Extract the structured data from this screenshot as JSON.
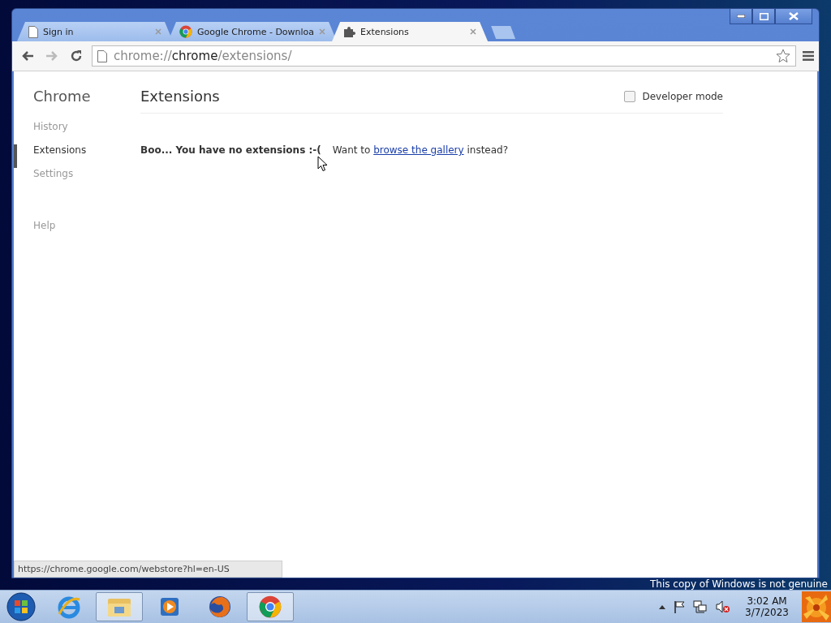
{
  "tabs": [
    {
      "title": "Sign in",
      "kind": "page",
      "selected": false
    },
    {
      "title": "Google Chrome - Downloa",
      "kind": "chrome",
      "selected": false
    },
    {
      "title": "Extensions",
      "kind": "puzzle",
      "selected": true
    }
  ],
  "toolbar": {
    "url_scheme": "chrome://",
    "url_host": "chrome",
    "url_path": "/extensions/"
  },
  "sidebar": {
    "title": "Chrome",
    "sections": [
      [
        {
          "label": "History",
          "selected": false
        },
        {
          "label": "Extensions",
          "selected": true
        },
        {
          "label": "Settings",
          "selected": false
        }
      ],
      [
        {
          "label": "Help",
          "selected": false
        }
      ]
    ]
  },
  "page": {
    "title": "Extensions",
    "developer_mode": {
      "label": "Developer mode",
      "checked": false
    },
    "empty_message": "Boo... You have no extensions :-(",
    "suggestion": {
      "before": "Want to",
      "link": "browse the gallery",
      "after": "instead?"
    }
  },
  "status_bubble": "https://chrome.google.com/webstore?hl=en-US",
  "desktop_notice": "This copy of Windows is not genuine",
  "taskbar": {
    "apps": [
      {
        "kind": "ie",
        "active": false
      },
      {
        "kind": "explorer",
        "active": true
      },
      {
        "kind": "media",
        "active": false
      },
      {
        "kind": "firefox",
        "active": false
      },
      {
        "kind": "chrome",
        "active": true
      }
    ],
    "clock": {
      "time": "3:02 AM",
      "date": "3/7/2023"
    }
  }
}
